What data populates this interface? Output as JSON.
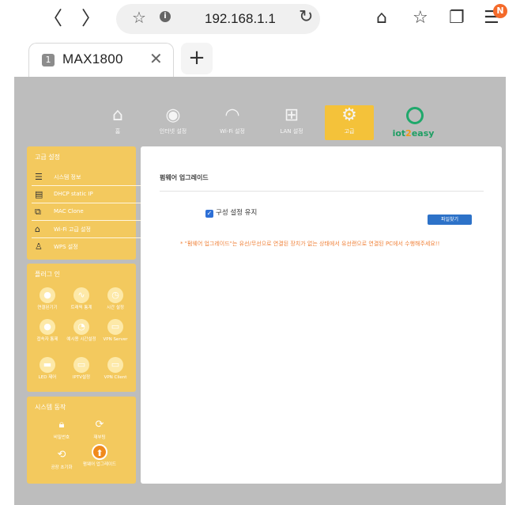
{
  "browser": {
    "back": "〈",
    "forward": "〉",
    "url": "192.168.1.1",
    "tab_title": "MAX1800",
    "tab_icon_text": "1",
    "notification_badge": "N"
  },
  "router": {
    "nav": [
      {
        "label": "홈",
        "icon": "home-icon"
      },
      {
        "label": "인터넷 설정",
        "icon": "globe-icon"
      },
      {
        "label": "Wi-Fi 설정",
        "icon": "wifi-icon"
      },
      {
        "label": "LAN 설정",
        "icon": "network-icon"
      },
      {
        "label": "고급",
        "icon": "gear-icon",
        "active": true
      }
    ],
    "brand": {
      "prefix": "iot",
      "highlight": "2",
      "suffix": "easy"
    },
    "sidebar_advanced": {
      "heading": "고급 설정",
      "items": [
        {
          "label": "시스템 정보",
          "icon": "list-icon"
        },
        {
          "label": "DHCP static IP",
          "icon": "dhcp-icon"
        },
        {
          "label": "MAC Clone",
          "icon": "mac-icon"
        },
        {
          "label": "Wi-Fi 고급 설정",
          "icon": "wifi-advanced-icon"
        },
        {
          "label": "WPS 설정",
          "icon": "wps-icon"
        }
      ]
    },
    "sidebar_plugins": {
      "heading": "플러그 인",
      "items": [
        {
          "label": "연결된기기"
        },
        {
          "label": "트래픽 통계"
        },
        {
          "label": "시간 설정"
        },
        {
          "label": "접속자 통제"
        },
        {
          "label": "예시용 시간설정"
        },
        {
          "label": "VPN Server"
        },
        {
          "label": "LED 제어"
        },
        {
          "label": "IPTV설정"
        },
        {
          "label": "VPN Client"
        }
      ]
    },
    "sidebar_system": {
      "heading": "시스템 동작",
      "items": [
        {
          "label": "비밀번호"
        },
        {
          "label": "재부팅"
        },
        {
          "label": "공장 초기화"
        },
        {
          "label": "펌웨어 업그레이드",
          "active": true
        }
      ]
    },
    "content": {
      "title": "펌웨어 업그레이드",
      "checkbox_label": "구성 설정 유지",
      "checkbox_checked": true,
      "file_button": "파일찾기",
      "notice": "* \"펌웨어 업그레이드\"는 유선/무선으로 연결된 장치가 없는 상태에서 유선랜으로 연결된 PC에서 수행해주세요!!"
    }
  },
  "colors": {
    "page_bg": "#bdbdbd",
    "accent_yellow": "#f3c95e",
    "active_nav": "#f4c23a",
    "button_blue": "#2d72c8",
    "notice_orange": "#f0823a"
  }
}
